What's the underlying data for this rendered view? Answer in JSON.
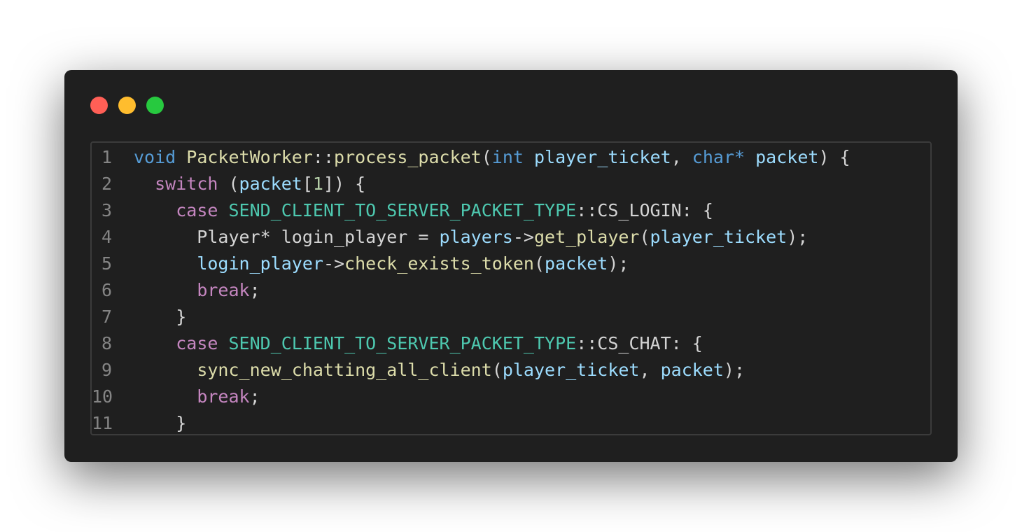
{
  "window": {
    "controls": [
      "close",
      "minimize",
      "maximize"
    ],
    "colors": {
      "close": "#ff5f56",
      "minimize": "#ffbd2e",
      "maximize": "#27c93f",
      "background": "#1f1f1f"
    }
  },
  "lines": [
    {
      "number": "1",
      "tokens": [
        {
          "t": "void",
          "c": "kw-blue"
        },
        {
          "t": " ",
          "c": "punc"
        },
        {
          "t": "PacketWorker",
          "c": "fn"
        },
        {
          "t": "::",
          "c": "punc"
        },
        {
          "t": "process_packet",
          "c": "fn"
        },
        {
          "t": "(",
          "c": "punc"
        },
        {
          "t": "int",
          "c": "kw-blue"
        },
        {
          "t": " ",
          "c": "punc"
        },
        {
          "t": "player_ticket",
          "c": "var"
        },
        {
          "t": ", ",
          "c": "punc"
        },
        {
          "t": "char*",
          "c": "kw-blue"
        },
        {
          "t": " ",
          "c": "punc"
        },
        {
          "t": "packet",
          "c": "var"
        },
        {
          "t": ") {",
          "c": "punc"
        }
      ]
    },
    {
      "number": "2",
      "tokens": [
        {
          "t": "  ",
          "c": "punc"
        },
        {
          "t": "switch",
          "c": "kw-purple"
        },
        {
          "t": " (",
          "c": "punc"
        },
        {
          "t": "packet",
          "c": "var"
        },
        {
          "t": "[",
          "c": "punc"
        },
        {
          "t": "1",
          "c": "num"
        },
        {
          "t": "]) {",
          "c": "punc"
        }
      ]
    },
    {
      "number": "3",
      "tokens": [
        {
          "t": "    ",
          "c": "punc"
        },
        {
          "t": "case",
          "c": "kw-purple"
        },
        {
          "t": " ",
          "c": "punc"
        },
        {
          "t": "SEND_CLIENT_TO_SERVER_PACKET_TYPE",
          "c": "type"
        },
        {
          "t": "::CS_LOGIN: {",
          "c": "punc"
        }
      ]
    },
    {
      "number": "4",
      "tokens": [
        {
          "t": "      Player* login_player = ",
          "c": "punc"
        },
        {
          "t": "players",
          "c": "var"
        },
        {
          "t": "->",
          "c": "punc"
        },
        {
          "t": "get_player",
          "c": "fn"
        },
        {
          "t": "(",
          "c": "punc"
        },
        {
          "t": "player_ticket",
          "c": "var"
        },
        {
          "t": ");",
          "c": "punc"
        }
      ]
    },
    {
      "number": "5",
      "tokens": [
        {
          "t": "      ",
          "c": "punc"
        },
        {
          "t": "login_player",
          "c": "var"
        },
        {
          "t": "->",
          "c": "punc"
        },
        {
          "t": "check_exists_token",
          "c": "fn"
        },
        {
          "t": "(",
          "c": "punc"
        },
        {
          "t": "packet",
          "c": "var"
        },
        {
          "t": ");",
          "c": "punc"
        }
      ]
    },
    {
      "number": "6",
      "tokens": [
        {
          "t": "      ",
          "c": "punc"
        },
        {
          "t": "break",
          "c": "kw-purple"
        },
        {
          "t": ";",
          "c": "punc"
        }
      ]
    },
    {
      "number": "7",
      "tokens": [
        {
          "t": "    }",
          "c": "punc"
        }
      ]
    },
    {
      "number": "8",
      "tokens": [
        {
          "t": "    ",
          "c": "punc"
        },
        {
          "t": "case",
          "c": "kw-purple"
        },
        {
          "t": " ",
          "c": "punc"
        },
        {
          "t": "SEND_CLIENT_TO_SERVER_PACKET_TYPE",
          "c": "type"
        },
        {
          "t": "::CS_CHAT: {",
          "c": "punc"
        }
      ]
    },
    {
      "number": "9",
      "tokens": [
        {
          "t": "      ",
          "c": "punc"
        },
        {
          "t": "sync_new_chatting_all_client",
          "c": "fn"
        },
        {
          "t": "(",
          "c": "punc"
        },
        {
          "t": "player_ticket",
          "c": "var"
        },
        {
          "t": ", ",
          "c": "punc"
        },
        {
          "t": "packet",
          "c": "var"
        },
        {
          "t": ");",
          "c": "punc"
        }
      ]
    },
    {
      "number": "10",
      "tokens": [
        {
          "t": "      ",
          "c": "punc"
        },
        {
          "t": "break",
          "c": "kw-purple"
        },
        {
          "t": ";",
          "c": "punc"
        }
      ]
    },
    {
      "number": "11",
      "tokens": [
        {
          "t": "    }",
          "c": "punc"
        }
      ]
    }
  ]
}
